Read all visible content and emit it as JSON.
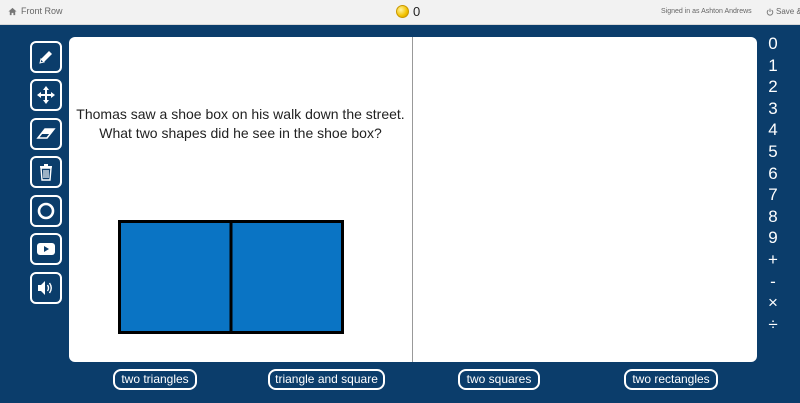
{
  "topbar": {
    "home_label": "Front Row",
    "coin_count": "0",
    "signed_in_text": "Signed in as Ashton Andrews",
    "save_label": "Save & C",
    "icons": {
      "home": "home-icon",
      "coin": "coin-icon",
      "power": "power-icon"
    }
  },
  "toolbar": {
    "tools": [
      {
        "name": "pencil-tool",
        "icon": "pencil-icon"
      },
      {
        "name": "move-tool",
        "icon": "move-arrows-icon"
      },
      {
        "name": "eraser-tool",
        "icon": "eraser-icon"
      },
      {
        "name": "trash-tool",
        "icon": "trash-icon"
      },
      {
        "name": "circle-tool",
        "icon": "circle-icon"
      },
      {
        "name": "video-tool",
        "icon": "play-icon"
      },
      {
        "name": "audio-tool",
        "icon": "speaker-icon"
      }
    ]
  },
  "question": {
    "line1": "Thomas saw a shoe box on his walk down the street.",
    "line2": "What two shapes did he see in the shoe box?"
  },
  "figure": {
    "fill_color": "#0a74c4",
    "stroke_color": "#000000"
  },
  "numpad": {
    "keys": [
      "0",
      "1",
      "2",
      "3",
      "4",
      "5",
      "6",
      "7",
      "8",
      "9",
      "+",
      "-",
      "×",
      "÷"
    ]
  },
  "answers": {
    "choices": [
      "two triangles",
      "triangle and square",
      "two squares",
      "two rectangles"
    ]
  },
  "colors": {
    "background": "#0b3d6b",
    "board": "#ffffff",
    "topbar": "#f2f2f2"
  }
}
